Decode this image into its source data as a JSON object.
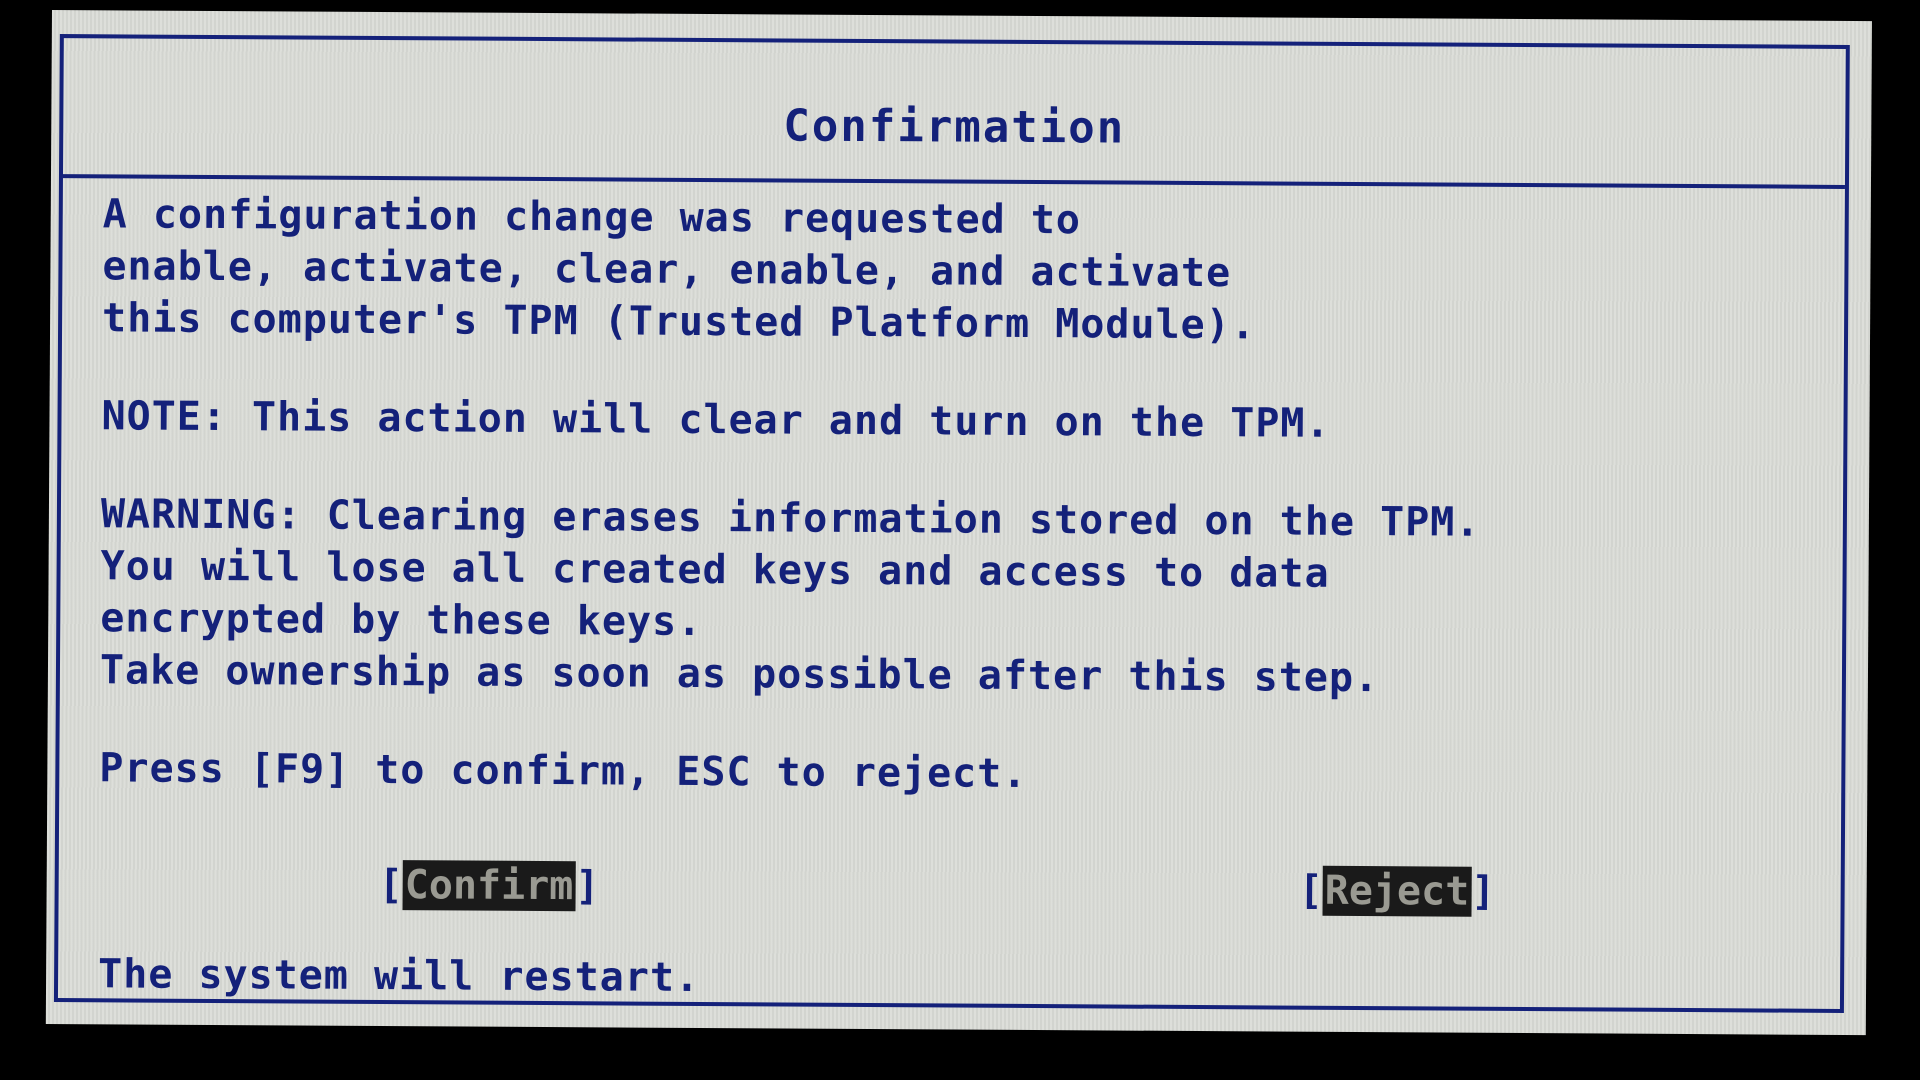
{
  "dialog": {
    "title": "Confirmation",
    "paragraphs": {
      "request": [
        "A configuration change was requested to",
        "enable, activate, clear, enable, and activate",
        "this computer's TPM (Trusted Platform Module)."
      ],
      "note": "NOTE: This action will clear and turn on the TPM.",
      "warning": [
        "WARNING: Clearing erases information stored on the TPM.",
        "You will lose all created keys and access to data",
        "encrypted by these keys.",
        "Take ownership as soon as possible after this step."
      ],
      "instruction": "Press [F9] to confirm, ESC to reject."
    },
    "buttons": {
      "confirm": {
        "bracket_open": "[",
        "label": "Confirm",
        "bracket_close": "]"
      },
      "reject": {
        "bracket_open": "[",
        "label": "Reject",
        "bracket_close": "]"
      }
    },
    "footer": "The system will restart."
  },
  "colors": {
    "text": "#14217a",
    "background": "#d9dbd6",
    "button_background": "#1a1a1a",
    "button_text": "#9a9a92"
  }
}
